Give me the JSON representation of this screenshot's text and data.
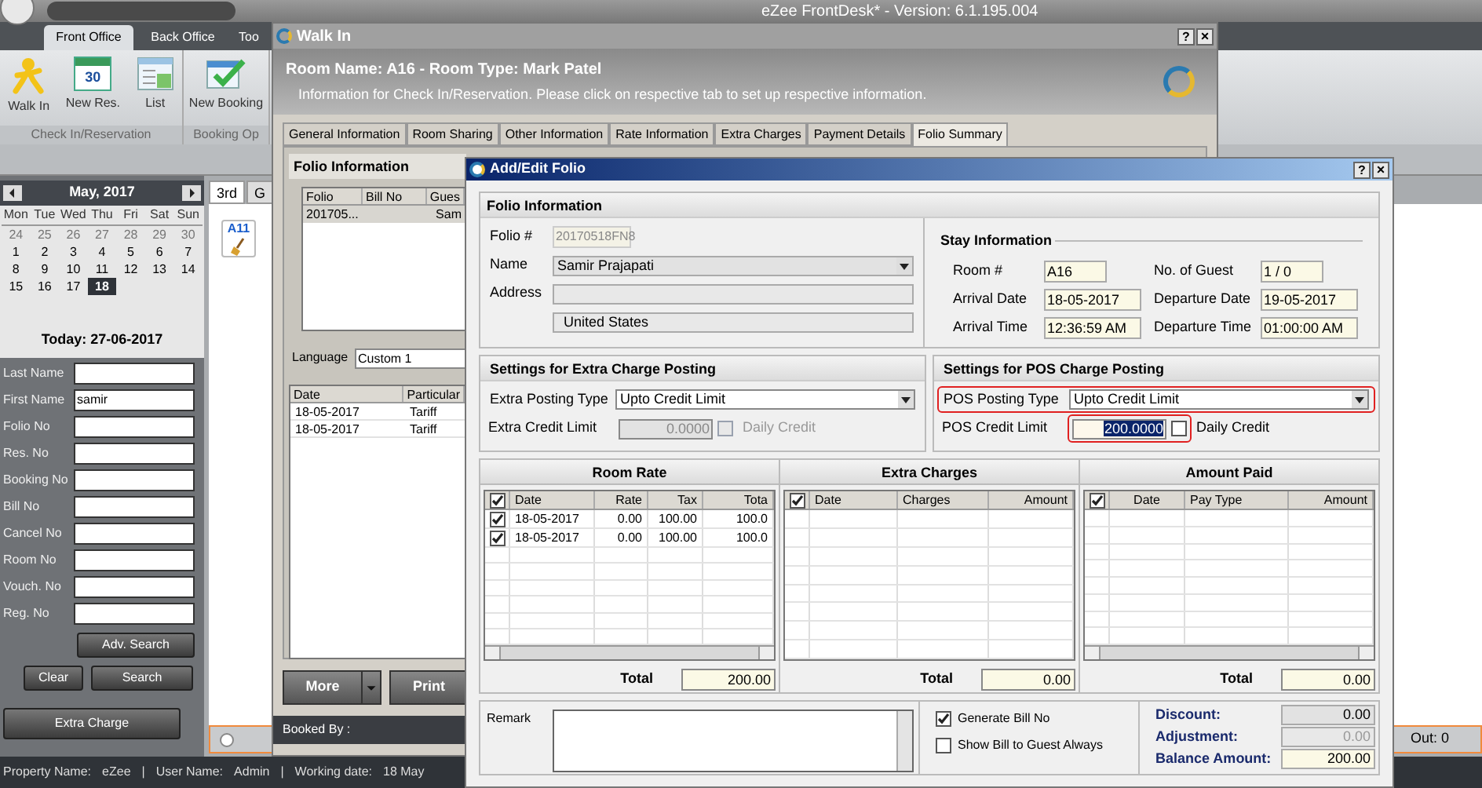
{
  "app": {
    "title": "eZee FrontDesk* - Version: 6.1.195.004",
    "ribbon_tabs": [
      {
        "label": "Front Office",
        "selected": true
      },
      {
        "label": "Back Office",
        "selected": false
      },
      {
        "label": "Too",
        "selected": false
      }
    ],
    "ribbon_groups": [
      {
        "label": "Check In/Reservation",
        "buttons": [
          {
            "label": "Walk In"
          },
          {
            "label": "New Res.",
            "icon_text": "30"
          },
          {
            "label": "List"
          }
        ]
      },
      {
        "label": "Booking Op",
        "buttons": [
          {
            "label": "New Booking"
          }
        ]
      }
    ]
  },
  "calendar": {
    "month": "May, 2017",
    "weekdays": [
      "Mon",
      "Tue",
      "Wed",
      "Thu",
      "Fri",
      "Sat",
      "Sun"
    ],
    "days": [
      {
        "label": "24",
        "other_month": true,
        "selected": false
      },
      {
        "label": "25",
        "other_month": true,
        "selected": false
      },
      {
        "label": "26",
        "other_month": true,
        "selected": false
      },
      {
        "label": "27",
        "other_month": true,
        "selected": false
      },
      {
        "label": "28",
        "other_month": true,
        "selected": false
      },
      {
        "label": "29",
        "other_month": true,
        "selected": false
      },
      {
        "label": "30",
        "other_month": true,
        "selected": false
      },
      {
        "label": "1",
        "other_month": false,
        "selected": false
      },
      {
        "label": "2",
        "other_month": false,
        "selected": false
      },
      {
        "label": "3",
        "other_month": false,
        "selected": false
      },
      {
        "label": "4",
        "other_month": false,
        "selected": false
      },
      {
        "label": "5",
        "other_month": false,
        "selected": false
      },
      {
        "label": "6",
        "other_month": false,
        "selected": false
      },
      {
        "label": "7",
        "other_month": false,
        "selected": false
      },
      {
        "label": "8",
        "other_month": false,
        "selected": false
      },
      {
        "label": "9",
        "other_month": false,
        "selected": false
      },
      {
        "label": "10",
        "other_month": false,
        "selected": false
      },
      {
        "label": "11",
        "other_month": false,
        "selected": false
      },
      {
        "label": "12",
        "other_month": false,
        "selected": false
      },
      {
        "label": "13",
        "other_month": false,
        "selected": false
      },
      {
        "label": "14",
        "other_month": false,
        "selected": false
      },
      {
        "label": "15",
        "other_month": false,
        "selected": false
      },
      {
        "label": "16",
        "other_month": false,
        "selected": false
      },
      {
        "label": "17",
        "other_month": false,
        "selected": false
      },
      {
        "label": "18",
        "other_month": false,
        "selected": true
      }
    ],
    "today": "Today: 27-06-2017"
  },
  "search": {
    "fields": [
      {
        "label": "Last Name"
      },
      {
        "label": "First Name",
        "value": "samir"
      },
      {
        "label": "Folio No"
      },
      {
        "label": "Res. No"
      },
      {
        "label": "Booking No"
      },
      {
        "label": "Bill No"
      },
      {
        "label": "Cancel No"
      },
      {
        "label": "Room No"
      },
      {
        "label": "Vouch. No"
      },
      {
        "label": "Reg. No"
      }
    ],
    "adv_search": "Adv. Search",
    "clear": "Clear",
    "search": "Search",
    "extra_charge": "Extra Charge"
  },
  "room_view": {
    "tabs": [
      {
        "label": "3rd",
        "selected": true
      },
      {
        "label": "G",
        "selected": false
      }
    ],
    "tile": "A11",
    "radio_selected": false,
    "out_count": "Out: 0"
  },
  "status_bar": {
    "separator": "|",
    "items": [
      {
        "label": "Property Name:",
        "value": "eZee"
      },
      {
        "label": "User Name:",
        "value": "Admin"
      },
      {
        "label": "Working date:",
        "value": "18 May"
      }
    ]
  },
  "walk_in": {
    "title": "Walk In",
    "help": "?",
    "close": "×",
    "room_name": "Room Name: A16 - Room Type: Mark Patel",
    "info": "Information for Check In/Reservation. Please click on respective tab to set up respective information.",
    "tabs": [
      {
        "label": "General Information",
        "selected": false
      },
      {
        "label": "Room Sharing",
        "selected": false
      },
      {
        "label": "Other Information",
        "selected": false
      },
      {
        "label": "Rate Information",
        "selected": false
      },
      {
        "label": "Extra Charges",
        "selected": false
      },
      {
        "label": "Payment Details",
        "selected": false
      },
      {
        "label": "Folio Summary",
        "selected": true
      }
    ],
    "folio_title": "Folio Information",
    "folio_columns": [
      "Folio",
      "Bill No",
      "Gues"
    ],
    "folio_rows": [
      {
        "folio": "201705...",
        "guest": "Sam"
      }
    ],
    "language_label": "Language",
    "language_value": "Custom 1",
    "charge_columns": [
      "Date",
      "Particular"
    ],
    "charge_rows": [
      {
        "date": "18-05-2017",
        "particular": "Tariff"
      },
      {
        "date": "18-05-2017",
        "particular": "Tariff"
      }
    ],
    "more": "More",
    "print": "Print",
    "booked_by": "Booked By :"
  },
  "dialog": {
    "title": "Add/Edit Folio",
    "help": "?",
    "close": "×",
    "folio": {
      "title": "Folio Information",
      "folio_label": "Folio #",
      "folio_value": "20170518FN8",
      "name_label": "Name",
      "name_value": "Samir Prajapati",
      "address_label": "Address",
      "country": "United States"
    },
    "stay": {
      "title": "Stay Information",
      "fields": [
        {
          "label": "Room #",
          "value": "A16"
        },
        {
          "label": "No. of Guest",
          "value": "1 / 0"
        },
        {
          "label": "Arrival Date",
          "value": "18-05-2017"
        },
        {
          "label": "Departure Date",
          "value": "19-05-2017"
        },
        {
          "label": "Arrival Time",
          "value": "12:36:59 AM"
        },
        {
          "label": "Departure Time",
          "value": "01:00:00 AM"
        }
      ]
    },
    "extra_posting": {
      "title": "Settings for Extra Charge Posting",
      "type_label": "Extra Posting Type",
      "type_value": "Upto Credit Limit",
      "type_highlighted": false,
      "limit_label": "Extra Credit Limit",
      "limit_value": "0.0000",
      "limit_disabled": true,
      "limit_selected": false,
      "limit_highlighted": false,
      "daily_label": "Daily Credit",
      "daily_checked": false
    },
    "pos_posting": {
      "title": "Settings for POS Charge Posting",
      "type_label": "POS Posting Type",
      "type_value": "Upto Credit Limit",
      "type_highlighted": true,
      "limit_label": "POS Credit Limit",
      "limit_value": "200.0000",
      "limit_disabled": false,
      "limit_selected": true,
      "limit_highlighted": true,
      "daily_label": "Daily Credit",
      "daily_checked": false
    },
    "grids": [
      {
        "title": "Room Rate",
        "header_checked": true,
        "columns": [
          "Date",
          "Rate",
          "Tax",
          "Tota"
        ],
        "rows": [
          {
            "checked": true,
            "cells": [
              "18-05-2017",
              "0.00",
              "100.00",
              "100.0"
            ]
          },
          {
            "checked": true,
            "cells": [
              "18-05-2017",
              "0.00",
              "100.00",
              "100.0"
            ]
          }
        ],
        "total_label": "Total",
        "total": "200.00"
      },
      {
        "title": "Extra Charges",
        "header_checked": true,
        "columns": [
          "Date",
          "Charges",
          "Amount"
        ],
        "total_label": "Total",
        "total": "0.00"
      },
      {
        "title": "Amount Paid",
        "header_checked": true,
        "columns": [
          "Date",
          "Pay Type",
          "Amount"
        ],
        "total_label": "Total",
        "total": "0.00"
      }
    ],
    "remark_label": "Remark",
    "options": [
      {
        "label": "Generate Bill No",
        "checked": true
      },
      {
        "label": "Show Bill to Guest Always",
        "checked": false
      }
    ],
    "summary": [
      {
        "label": "Discount:",
        "value": "0.00",
        "disabled": false
      },
      {
        "label": "Adjustment:",
        "value": "0.00",
        "disabled": true
      },
      {
        "label": "Balance Amount:",
        "value": "200.00",
        "disabled": false
      }
    ]
  }
}
